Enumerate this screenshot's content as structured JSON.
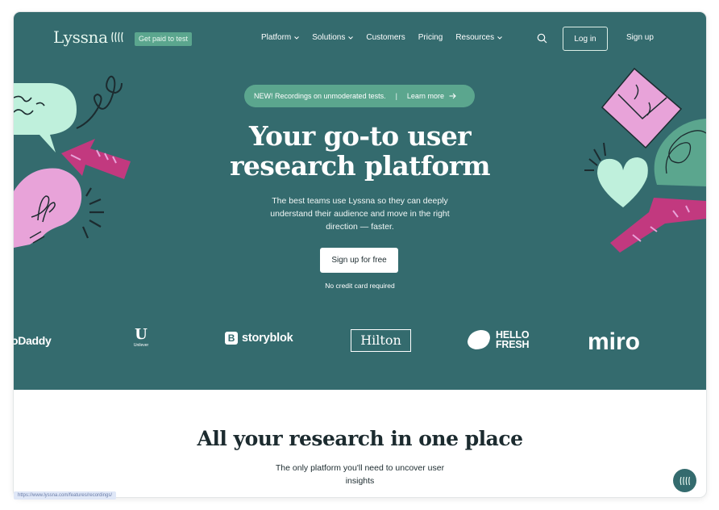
{
  "nav": {
    "logo_text": "Lyssna",
    "badge": "Get paid to test",
    "links": [
      {
        "label": "Platform"
      },
      {
        "label": "Solutions"
      },
      {
        "label": "Customers"
      },
      {
        "label": "Pricing"
      },
      {
        "label": "Resources"
      }
    ],
    "login": "Log in",
    "signup": "Sign up"
  },
  "hero": {
    "announcement": "NEW! Recordings on unmoderated tests.",
    "announcement_link": "Learn more",
    "headline_line1": "Your go-to user",
    "headline_line2": "research platform",
    "subtext": "The best teams use Lyssna so they can deeply understand their audience and move in the right direction — faster.",
    "cta": "Sign up for free",
    "note": "No credit card required"
  },
  "brands": {
    "godaddy": "oDaddy",
    "unilever": "Unilever",
    "storyblok": "storyblok",
    "hilton": "Hilton",
    "hellofresh_line1": "HELLO",
    "hellofresh_line2": "FRESH",
    "miro": "miro"
  },
  "section": {
    "title": "All your research in one place",
    "subtitle": "The only platform you'll need to uncover user insights"
  },
  "status_bar_url": "https://www.lyssna.com/features/recordings/",
  "colors": {
    "hero_bg": "#346b6e",
    "mint": "#bff0dc",
    "pink": "#e8a3d9",
    "magenta": "#c2397f",
    "accent_green": "#5ba68e"
  }
}
